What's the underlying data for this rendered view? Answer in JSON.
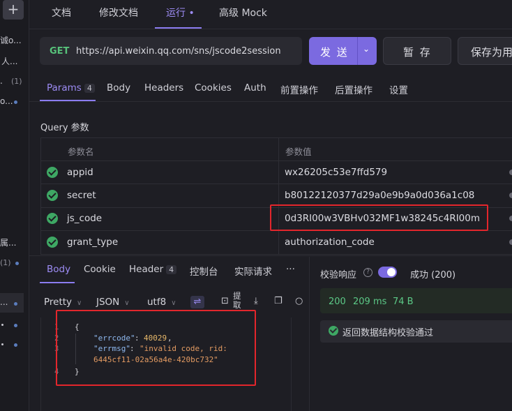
{
  "sidebar": {
    "add_label": "+",
    "fragments": [
      "诚o...",
      "人...",
      ".",
      "o...",
      "属...",
      "..."
    ],
    "counts": [
      "(1)",
      "(1)"
    ]
  },
  "top_tabs": [
    {
      "label": "文档"
    },
    {
      "label": "修改文档"
    },
    {
      "label": "运行 •"
    },
    {
      "label": "高级 Mock"
    }
  ],
  "request": {
    "method": "GET",
    "url": "https://api.weixin.qq.com/sns/jscode2session",
    "send_label": "发 送",
    "save_label": "暂 存",
    "save_as_label": "保存为用"
  },
  "request_tabs": {
    "params": "Params",
    "params_count": "4",
    "body": "Body",
    "headers": "Headers",
    "cookies": "Cookies",
    "auth": "Auth",
    "pre": "前置操作",
    "post": "后置操作",
    "settings": "设置"
  },
  "query": {
    "title": "Query 参数",
    "col_name": "参数名",
    "col_value": "参数值",
    "rows": [
      {
        "name": "appid",
        "value": "wx26205c53e7ffd579"
      },
      {
        "name": "secret",
        "value": "b80122120377d29a0e9b9a0d036a1c08"
      },
      {
        "name": "js_code",
        "value": "0d3RI00w3VBHv032MF1w38245c4RI00m"
      },
      {
        "name": "grant_type",
        "value": "authorization_code"
      }
    ]
  },
  "response_tabs": {
    "body": "Body",
    "cookie": "Cookie",
    "header": "Header",
    "header_count": "4",
    "console": "控制台",
    "actual": "实际请求",
    "more": "···"
  },
  "toolbar": {
    "format": "Pretty",
    "type": "JSON",
    "encoding": "utf8",
    "extract": "提取"
  },
  "code": {
    "lines": [
      "1",
      "2",
      "3",
      "",
      "4"
    ],
    "open": "{",
    "errcode_key": "\"errcode\"",
    "errcode_val": "40029",
    "errmsg_key": "\"errmsg\"",
    "errmsg_val1": "\"invalid code, rid:",
    "errmsg_val2": "6445cf11-02a56a4e-420bc732\"",
    "close": "}"
  },
  "verify": {
    "label": "校验响应",
    "help": "?",
    "enabled": true,
    "status": "成功 (200)",
    "code": "200",
    "time": "209 ms",
    "size": "74 B",
    "result": "返回数据结构校验通过"
  },
  "colors": {
    "accent": "#8b7cf0",
    "success": "#3ea864",
    "highlight": "#e3262c"
  }
}
